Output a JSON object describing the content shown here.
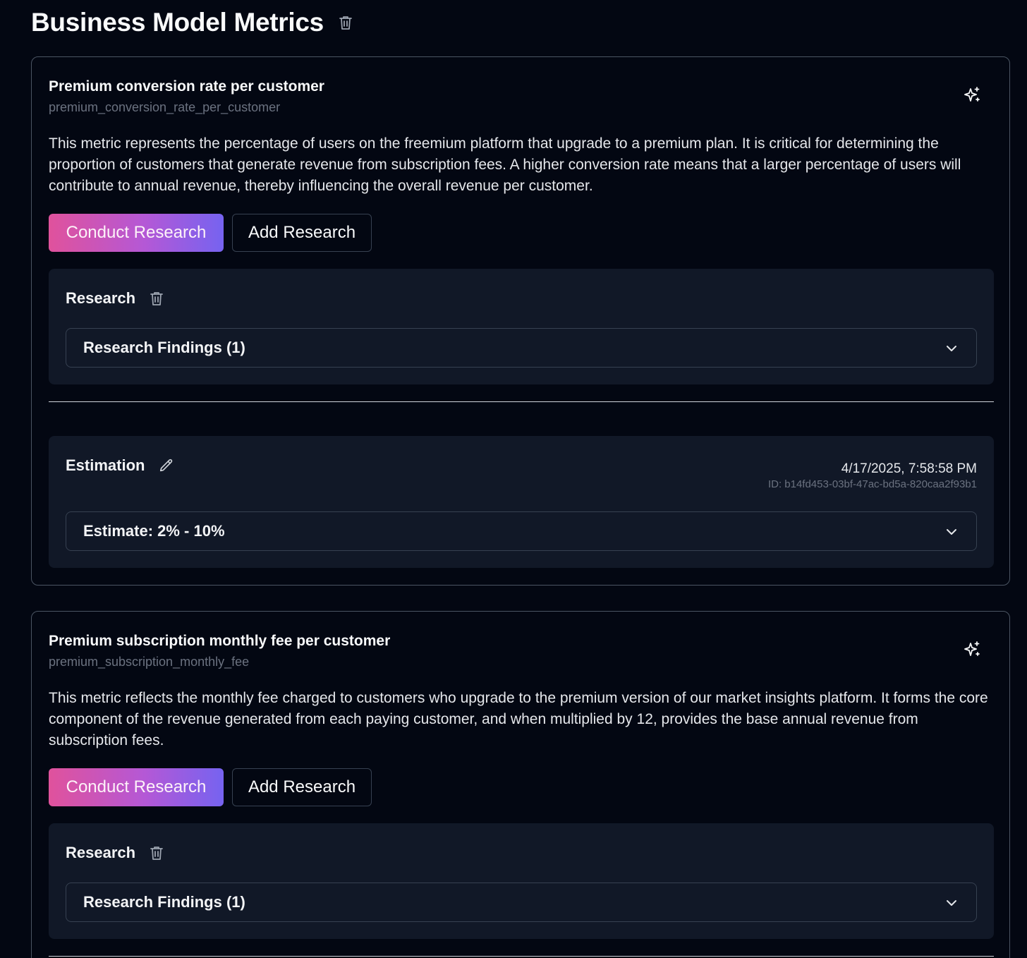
{
  "page": {
    "title": "Business Model Metrics"
  },
  "metrics": [
    {
      "title": "Premium conversion rate per customer",
      "key": "premium_conversion_rate_per_customer",
      "description": "This metric represents the percentage of users on the freemium platform that upgrade to a premium plan. It is critical for determining the proportion of customers that generate revenue from subscription fees. A higher conversion rate means that a larger percentage of users will contribute to annual revenue, thereby influencing the overall revenue per customer.",
      "conduct_label": "Conduct Research",
      "add_label": "Add Research",
      "research": {
        "label": "Research",
        "findings_label": "Research Findings (1)"
      },
      "estimation": {
        "label": "Estimation",
        "timestamp": "4/17/2025, 7:58:58 PM",
        "id": "ID: b14fd453-03bf-47ac-bd5a-820caa2f93b1",
        "estimate_label": "Estimate: 2% - 10%"
      }
    },
    {
      "title": "Premium subscription monthly fee per customer",
      "key": "premium_subscription_monthly_fee",
      "description": "This metric reflects the monthly fee charged to customers who upgrade to the premium version of our market insights platform. It forms the core component of the revenue generated from each paying customer, and when multiplied by 12, provides the base annual revenue from subscription fees.",
      "conduct_label": "Conduct Research",
      "add_label": "Add Research",
      "research": {
        "label": "Research",
        "findings_label": "Research Findings (1)"
      }
    }
  ],
  "icons": {
    "header": "trash-icon",
    "metric_action": "sparkle-icon",
    "research": "trash-icon",
    "estimation": "pencil-icon",
    "accordion": "chevron-down-icon"
  },
  "colors": {
    "background": "#030712",
    "panel": "#111827",
    "border": "#374151",
    "gradient_start": "#e0529c",
    "gradient_end": "#7663f0"
  }
}
